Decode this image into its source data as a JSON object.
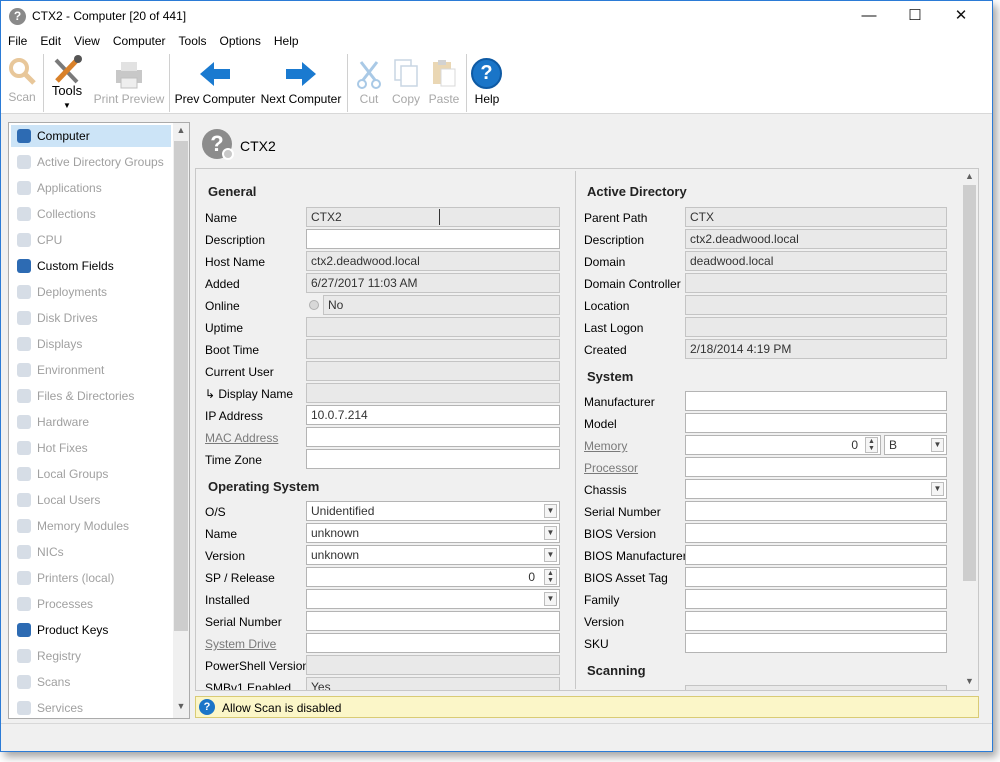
{
  "window": {
    "title": "CTX2 - Computer [20 of 441]",
    "minimize": "—",
    "maximize": "☐",
    "close": "✕"
  },
  "menu": [
    "File",
    "Edit",
    "View",
    "Computer",
    "Tools",
    "Options",
    "Help"
  ],
  "toolbar": {
    "scan": "Scan",
    "tools": "Tools",
    "print_preview": "Print Preview",
    "prev_computer": "Prev Computer",
    "next_computer": "Next Computer",
    "cut": "Cut",
    "copy": "Copy",
    "paste": "Paste",
    "help": "Help"
  },
  "nav": [
    {
      "label": "Computer",
      "state": "selected"
    },
    {
      "label": "Active Directory Groups",
      "state": "disabled"
    },
    {
      "label": "Applications",
      "state": "disabled"
    },
    {
      "label": "Collections",
      "state": "disabled"
    },
    {
      "label": "CPU",
      "state": "disabled"
    },
    {
      "label": "Custom Fields",
      "state": "enabled"
    },
    {
      "label": "Deployments",
      "state": "disabled"
    },
    {
      "label": "Disk Drives",
      "state": "disabled"
    },
    {
      "label": "Displays",
      "state": "disabled"
    },
    {
      "label": "Environment",
      "state": "disabled"
    },
    {
      "label": "Files & Directories",
      "state": "disabled"
    },
    {
      "label": "Hardware",
      "state": "disabled"
    },
    {
      "label": "Hot Fixes",
      "state": "disabled"
    },
    {
      "label": "Local Groups",
      "state": "disabled"
    },
    {
      "label": "Local Users",
      "state": "disabled"
    },
    {
      "label": "Memory Modules",
      "state": "disabled"
    },
    {
      "label": "NICs",
      "state": "disabled"
    },
    {
      "label": "Printers (local)",
      "state": "disabled"
    },
    {
      "label": "Processes",
      "state": "disabled"
    },
    {
      "label": "Product Keys",
      "state": "enabled"
    },
    {
      "label": "Registry",
      "state": "disabled"
    },
    {
      "label": "Scans",
      "state": "disabled"
    },
    {
      "label": "Services",
      "state": "disabled"
    }
  ],
  "header": {
    "computer_name": "CTX2",
    "icon": "question-mark-computer-icon"
  },
  "general": {
    "title": "General",
    "name_label": "Name",
    "name_value": "CTX2",
    "description_label": "Description",
    "description_value": "",
    "host_name_label": "Host Name",
    "host_name_value": "ctx2.deadwood.local",
    "added_label": "Added",
    "added_value": "6/27/2017 11:03 AM",
    "online_label": "Online",
    "online_value": "No",
    "uptime_label": "Uptime",
    "uptime_value": "",
    "boot_time_label": "Boot Time",
    "boot_time_value": "",
    "current_user_label": "Current User",
    "current_user_value": "",
    "display_name_label": "↳ Display Name",
    "display_name_value": "",
    "ip_label": "IP Address",
    "ip_value": "10.0.7.214",
    "mac_label": "MAC Address",
    "mac_value": "",
    "time_zone_label": "Time Zone",
    "time_zone_value": ""
  },
  "os": {
    "title": "Operating System",
    "os_label": "O/S",
    "os_value": "Unidentified",
    "name_label": "Name",
    "name_value": "unknown",
    "version_label": "Version",
    "version_value": "unknown",
    "sp_label": "SP / Release",
    "sp_value": "0",
    "installed_label": "Installed",
    "installed_value": "",
    "serial_label": "Serial Number",
    "serial_value": "",
    "system_drive_label": "System Drive",
    "system_drive_value": "",
    "powershell_label": "PowerShell Version",
    "powershell_value": "",
    "smbv1_label": "SMBv1 Enabled",
    "smbv1_value": "Yes"
  },
  "ad": {
    "title": "Active Directory",
    "parent_path_label": "Parent Path",
    "parent_path_value": "CTX",
    "description_label": "Description",
    "description_value": "ctx2.deadwood.local",
    "domain_label": "Domain",
    "domain_value": "deadwood.local",
    "dc_label": "Domain Controller",
    "dc_value": "",
    "location_label": "Location",
    "location_value": "",
    "last_logon_label": "Last Logon",
    "last_logon_value": "",
    "created_label": "Created",
    "created_value": "2/18/2014 4:19 PM"
  },
  "system": {
    "title": "System",
    "manufacturer_label": "Manufacturer",
    "manufacturer_value": "",
    "model_label": "Model",
    "model_value": "",
    "memory_label": "Memory",
    "memory_value": "0",
    "memory_unit": "B",
    "processor_label": "Processor",
    "processor_value": "",
    "chassis_label": "Chassis",
    "chassis_value": "",
    "serial_label": "Serial Number",
    "serial_value": "",
    "bios_version_label": "BIOS Version",
    "bios_version_value": "",
    "bios_manufacturer_label": "BIOS Manufacturer",
    "bios_manufacturer_value": "",
    "bios_asset_label": "BIOS Asset Tag",
    "bios_asset_value": "",
    "family_label": "Family",
    "family_value": "",
    "version_label": "Version",
    "version_value": "",
    "sku_label": "SKU",
    "sku_value": ""
  },
  "scanning": {
    "title": "Scanning"
  },
  "status": {
    "message": "Allow Scan is disabled"
  },
  "colors": {
    "accent": "#0078d7",
    "selection": "#cce4f7",
    "status_bg": "#fbf6c8",
    "arrow_blue": "#1a7ad0"
  }
}
